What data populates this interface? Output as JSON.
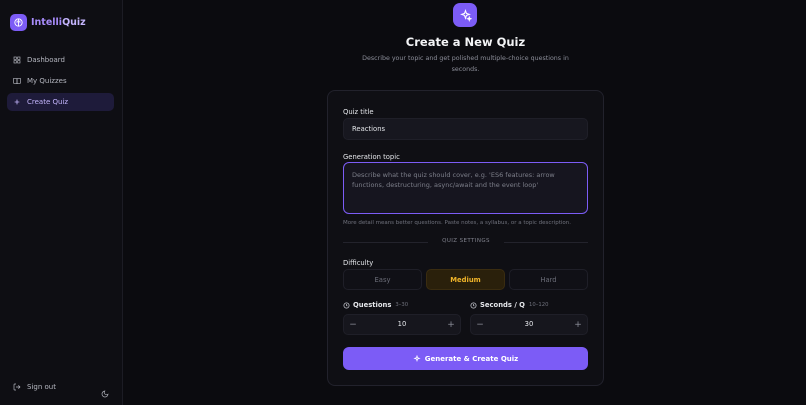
{
  "app": {
    "name_part1": "Intelli",
    "name_part2": "Quiz"
  },
  "sidebar": {
    "items": [
      {
        "label": "Dashboard",
        "icon": "grid-icon"
      },
      {
        "label": "My Quizzes",
        "icon": "book-icon"
      },
      {
        "label": "Create Quiz",
        "icon": "plus-icon",
        "active": true
      }
    ],
    "signout_label": "Sign out"
  },
  "page": {
    "title": "Create a New Quiz",
    "subtitle": "Describe your topic and get polished multiple-choice questions in seconds."
  },
  "form": {
    "quiz_title_label": "Quiz title",
    "quiz_title_value": "Reactions",
    "topic_label": "Generation topic",
    "topic_placeholder": "Describe what the quiz should cover, e.g. 'ES6 features: arrow functions, destructuring, async/await and the event loop'",
    "topic_hint": "More detail means better questions. Paste notes, a syllabus, or a topic description.",
    "settings_label": "QUIZ SETTINGS",
    "difficulty_label": "Difficulty",
    "difficulty_options": [
      "Easy",
      "Medium",
      "Hard"
    ],
    "difficulty_selected": "Medium",
    "questions_label": "Questions",
    "questions_range": "3–30",
    "questions_value": "10",
    "seconds_label": "Seconds / Q",
    "seconds_range": "10–120",
    "seconds_value": "30",
    "minus_symbol": "−",
    "plus_symbol": "+",
    "generate_label": "Generate & Create Quiz"
  },
  "colors": {
    "accent": "#7c5cf6",
    "medium": "#f0b429",
    "background": "#0b0b0f"
  }
}
